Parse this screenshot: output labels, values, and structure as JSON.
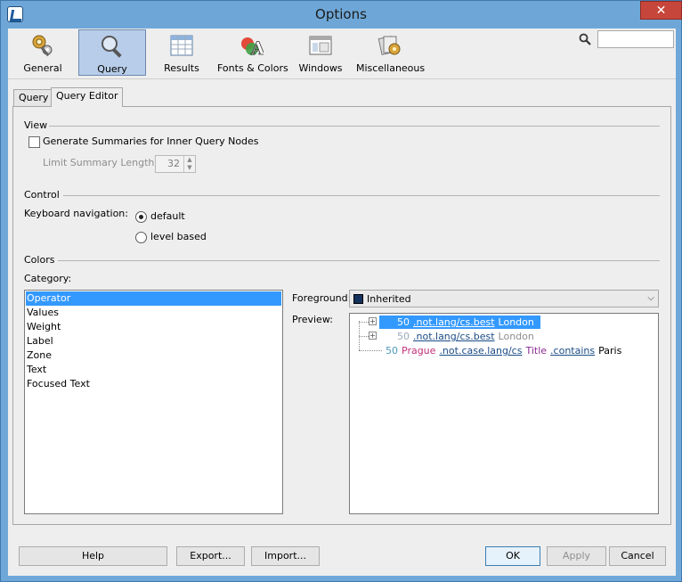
{
  "window": {
    "title": "Options",
    "close_glyph": "✕"
  },
  "toolbar": {
    "items": [
      {
        "label": "General",
        "icon": "gears-icon"
      },
      {
        "label": "Query",
        "icon": "magnifier-icon",
        "selected": true
      },
      {
        "label": "Results",
        "icon": "table-icon"
      },
      {
        "label": "Fonts & Colors",
        "icon": "fonts-colors-icon"
      },
      {
        "label": "Windows",
        "icon": "windows-icon"
      },
      {
        "label": "Miscellaneous",
        "icon": "misc-icon"
      }
    ],
    "search_value": ""
  },
  "tabs": [
    {
      "label": "Query",
      "active": false
    },
    {
      "label": "Query Editor",
      "active": true
    }
  ],
  "view": {
    "title": "View",
    "generate_summaries_label": "Generate Summaries for Inner Query Nodes",
    "generate_summaries_checked": false,
    "limit_label": "Limit Summary Length to:",
    "limit_value": "32"
  },
  "control": {
    "title": "Control",
    "keyboard_label": "Keyboard navigation:",
    "options": [
      "default",
      "level based"
    ],
    "selected": "default"
  },
  "colors": {
    "title": "Colors",
    "category_label": "Category:",
    "categories": [
      "Operator",
      "Values",
      "Weight",
      "Label",
      "Zone",
      "Text",
      "Focused Text"
    ],
    "selected_category": "Operator",
    "foreground_label": "Foreground:",
    "foreground_value": "Inherited",
    "foreground_color": "#15325e",
    "preview_label": "Preview:",
    "preview_rows": [
      {
        "weight": "50",
        "zone": ".not.lang/cs.best",
        "text": "London",
        "selected": true
      },
      {
        "weight": "50",
        "zone": ".not.lang/cs.best",
        "text": "London",
        "selected": false
      },
      {
        "weight": "50",
        "value": "Prague",
        "zone": ".not.case.lang/cs",
        "label": "Title",
        "op": ".contains",
        "text": "Paris"
      }
    ]
  },
  "buttons": {
    "help": "Help",
    "export": "Export...",
    "import": "Import...",
    "ok": "OK",
    "apply": "Apply",
    "cancel": "Cancel"
  },
  "palette": {
    "accent": "#3399ff",
    "weight": "#4f9ab7",
    "value": "#c0307a",
    "zone": "#1a4b86",
    "label": "#8a2a92",
    "muted": "#8e8e8e"
  }
}
